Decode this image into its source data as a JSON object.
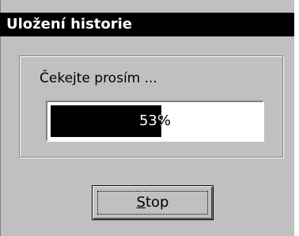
{
  "window": {
    "title": "Uložení historie"
  },
  "dialog": {
    "message": "Čekejte prosím ...",
    "progress": {
      "percent": 53,
      "label": "53%"
    },
    "stop_button": {
      "label_mnemonic": "S",
      "label_rest": "top"
    }
  },
  "colors": {
    "face": "#c0c0c0",
    "titlebar": "#000000",
    "title_text": "#ffffff",
    "progress_fill": "#000000",
    "progress_track": "#ffffff"
  }
}
